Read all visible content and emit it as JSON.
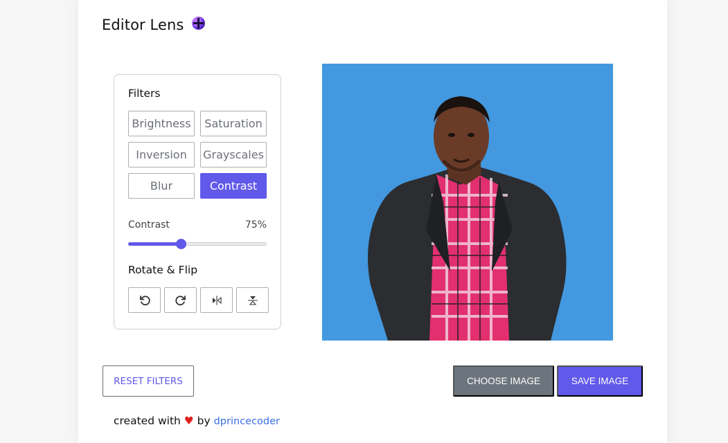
{
  "app": {
    "title": "Editor Lens",
    "logo_icon": "crystal-ball-logo"
  },
  "filters": {
    "title": "Filters",
    "buttons": [
      {
        "label": "Brightness",
        "active": false
      },
      {
        "label": "Saturation",
        "active": false
      },
      {
        "label": "Inversion",
        "active": false
      },
      {
        "label": "Grayscales",
        "active": false
      },
      {
        "label": "Blur",
        "active": false
      },
      {
        "label": "Contrast",
        "active": true
      }
    ],
    "selected": "Contrast"
  },
  "slider": {
    "label": "Contrast",
    "value_text": "75%",
    "fraction": 0.38
  },
  "rotate_flip": {
    "title": "Rotate & Flip",
    "icons": [
      "rotate-left-icon",
      "rotate-right-icon",
      "flip-horizontal-icon",
      "flip-vertical-icon"
    ]
  },
  "preview": {
    "background": "#4398df"
  },
  "actions": {
    "reset": "RESET FILTERS",
    "choose": "CHOOSE IMAGE",
    "save": "SAVE IMAGE"
  },
  "footer": {
    "prefix": "created with",
    "heart": "♥",
    "by": "by",
    "author": "dprincecoder"
  },
  "colors": {
    "accent": "#6159e9",
    "secondary": "#6c757d",
    "link": "#3a6fe6",
    "heart": "#e0201e"
  }
}
